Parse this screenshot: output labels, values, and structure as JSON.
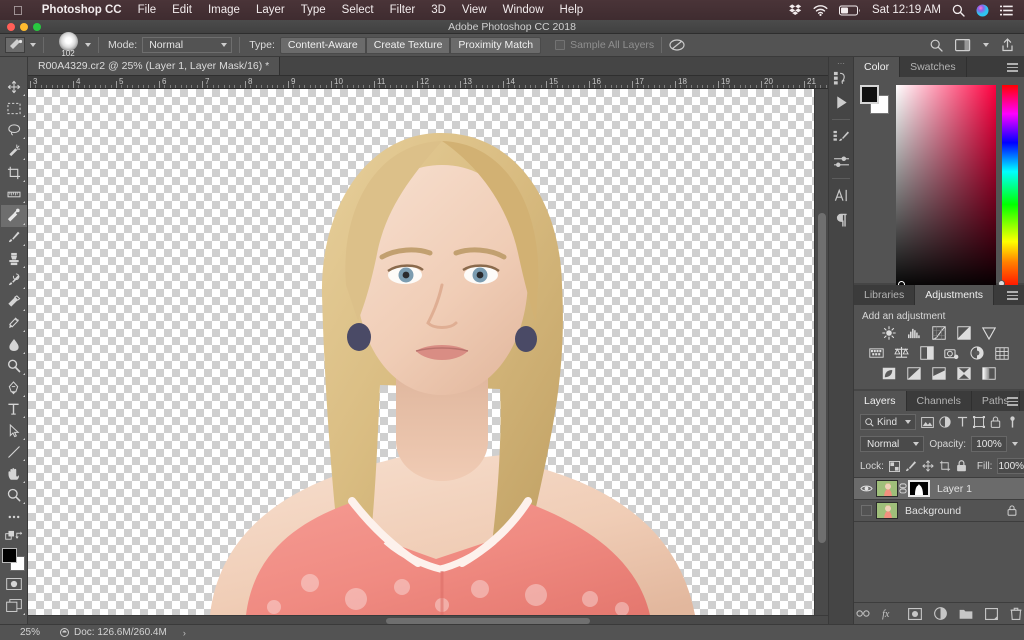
{
  "macbar": {
    "apple": "apple-logo",
    "items": [
      {
        "label": "Photoshop CC",
        "bold": true
      },
      {
        "label": "File",
        "bold": false
      },
      {
        "label": "Edit",
        "bold": false
      },
      {
        "label": "Image",
        "bold": false
      },
      {
        "label": "Layer",
        "bold": false
      },
      {
        "label": "Type",
        "bold": false
      },
      {
        "label": "Select",
        "bold": false
      },
      {
        "label": "Filter",
        "bold": false
      },
      {
        "label": "3D",
        "bold": false
      },
      {
        "label": "View",
        "bold": false
      },
      {
        "label": "Window",
        "bold": false
      },
      {
        "label": "Help",
        "bold": false
      }
    ],
    "clock": "Sat 12:19 AM",
    "status_icons": [
      "dropbox-icon",
      "wifi-icon",
      "battery-icon",
      "spotlight-search-icon",
      "siri-icon",
      "notification-center-icon"
    ]
  },
  "titlebar": {
    "title": "Adobe Photoshop CC 2018",
    "buttons": [
      "close-button",
      "minimize-button",
      "maximize-button"
    ]
  },
  "optionsbar": {
    "tool_preset_label": "spot-healing-brush-preset",
    "brush_size": "102",
    "mode_label": "Mode:",
    "mode_value": "Normal",
    "type_label": "Type:",
    "type_options": [
      "Content-Aware",
      "Create Texture",
      "Proximity Match"
    ],
    "type_selected": "Content-Aware",
    "sample_all_layers": "Sample All Layers",
    "sample_all_checked": false,
    "pressure_icon": "pressure-toggle-icon",
    "right_icons": [
      "search-icon",
      "workspace-switcher-icon",
      "share-icon"
    ]
  },
  "tabbar": {
    "move_tool_icon": "move-tool-icon",
    "document_tab": "R00A4329.cr2 @ 25% (Layer 1, Layer Mask/16) *"
  },
  "toolbar": {
    "tools": [
      {
        "name": "move-tool",
        "active": false
      },
      {
        "name": "rectangular-marquee-tool",
        "active": false
      },
      {
        "name": "lasso-tool",
        "active": false
      },
      {
        "name": "quick-selection-tool",
        "active": false
      },
      {
        "name": "crop-tool",
        "active": false
      },
      {
        "name": "eyedropper-tool",
        "active": false
      },
      {
        "name": "spot-healing-brush-tool",
        "active": true
      },
      {
        "name": "brush-tool",
        "active": false
      },
      {
        "name": "clone-stamp-tool",
        "active": false
      },
      {
        "name": "history-brush-tool",
        "active": false
      },
      {
        "name": "eraser-tool",
        "active": false
      },
      {
        "name": "gradient-tool",
        "active": false
      },
      {
        "name": "blur-tool",
        "active": false
      },
      {
        "name": "dodge-tool",
        "active": false
      },
      {
        "name": "pen-tool",
        "active": false
      },
      {
        "name": "type-tool",
        "active": false
      },
      {
        "name": "path-selection-tool",
        "active": false
      },
      {
        "name": "line-tool",
        "active": false
      },
      {
        "name": "hand-tool",
        "active": false
      },
      {
        "name": "zoom-tool",
        "active": false
      },
      {
        "name": "edit-toolbar-tool",
        "active": false
      }
    ],
    "quickmask_icon": "quick-mask-icon",
    "screenmode_icon": "screen-mode-icon",
    "foreground_color": "#000000",
    "background_color": "#ffffff"
  },
  "ruler": {
    "unit_start": 3,
    "labels": [
      3,
      4,
      5,
      6,
      7,
      8,
      9,
      10,
      11,
      12,
      13,
      14,
      15,
      16,
      17,
      18,
      19,
      20,
      21
    ],
    "spacing_px": 43
  },
  "statusbar": {
    "zoom": "25%",
    "doc": "Doc: 126.6M/260.4M",
    "arrow": "›"
  },
  "rail": {
    "icons": [
      "history-panel-icon",
      "actions-panel-icon",
      "brush-settings-panel-icon",
      "brush-presets-panel-icon",
      "character-panel-icon",
      "paragraph-panel-icon"
    ]
  },
  "color_panel": {
    "tabs": [
      {
        "label": "Color",
        "active": true
      },
      {
        "label": "Swatches",
        "active": false
      }
    ],
    "foreground": "#000000",
    "background": "#ffffff",
    "hue": "#ff0040"
  },
  "adjustments_panel": {
    "tabs": [
      {
        "label": "Libraries",
        "active": false
      },
      {
        "label": "Adjustments",
        "active": true
      }
    ],
    "title": "Add an adjustment",
    "rows": [
      [
        "brightness-contrast-icon",
        "levels-icon",
        "curves-icon",
        "exposure-icon",
        "vibrance-icon"
      ],
      [
        "hue-saturation-icon",
        "color-balance-icon",
        "black-white-icon",
        "photo-filter-icon",
        "channel-mixer-icon",
        "color-lookup-icon"
      ],
      [
        "invert-icon",
        "posterize-icon",
        "threshold-icon",
        "selective-color-icon",
        "gradient-map-icon"
      ]
    ]
  },
  "layers_panel": {
    "tabs": [
      {
        "label": "Layers",
        "active": true
      },
      {
        "label": "Channels",
        "active": false
      },
      {
        "label": "Paths",
        "active": false
      }
    ],
    "filter_label": "Kind",
    "filter_icons": [
      "pixel-filter-icon",
      "adjustment-filter-icon",
      "type-filter-icon",
      "shape-filter-icon",
      "smartobject-filter-icon"
    ],
    "toggle_icon": "filter-toggle-icon",
    "blend_mode": "Normal",
    "opacity_label": "Opacity:",
    "opacity_value": "100%",
    "lock_label": "Lock:",
    "lock_icons": [
      "lock-transparent-pixels-icon",
      "lock-image-pixels-icon",
      "lock-position-icon",
      "lock-artboard-icon",
      "lock-all-icon"
    ],
    "fill_label": "Fill:",
    "fill_value": "100%",
    "layers": [
      {
        "name": "Layer 1",
        "visible": true,
        "selected": true,
        "has_mask": true,
        "locked": false
      },
      {
        "name": "Background",
        "visible": false,
        "selected": false,
        "has_mask": false,
        "locked": true
      }
    ],
    "bottom_buttons": [
      "link-layers-icon",
      "layer-style-icon",
      "add-layer-mask-icon",
      "new-adjustment-layer-icon",
      "new-group-icon",
      "new-layer-icon",
      "delete-layer-icon"
    ]
  }
}
